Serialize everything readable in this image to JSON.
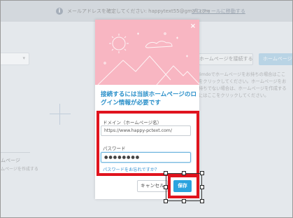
{
  "notice": {
    "text": "メールアドレスを確定してください: happytext55@gmail.com",
    "link": "プロフィールに移動する"
  },
  "background": {
    "connect_button": "ホームページを接続する",
    "create_button": "ホームページ",
    "description": "Jimdoでホームページをお持ちの場合はここをクリックしてください。ホームページをお持ちでない場合は、ホームページを作成するにはここをクリックしてください。",
    "left_title": "ムページ",
    "left_sub": "ムページを作成する"
  },
  "modal": {
    "close": "×",
    "title": "接続するには当該ホームページのログイン情報が必要です",
    "domain_label": "ドメイン（ホームページ名）",
    "domain_value": "https://www.happy-pctext.com/",
    "password_label": "パスワード",
    "password_value": "●●●●●●●●",
    "forgot_link": "パスワードをお忘れですか？",
    "cancel_button": "キャンセル",
    "save_button": "保存"
  },
  "colors": {
    "accent": "#2ba3df",
    "highlight": "#e0141e",
    "hero": "#f8b6c2"
  }
}
